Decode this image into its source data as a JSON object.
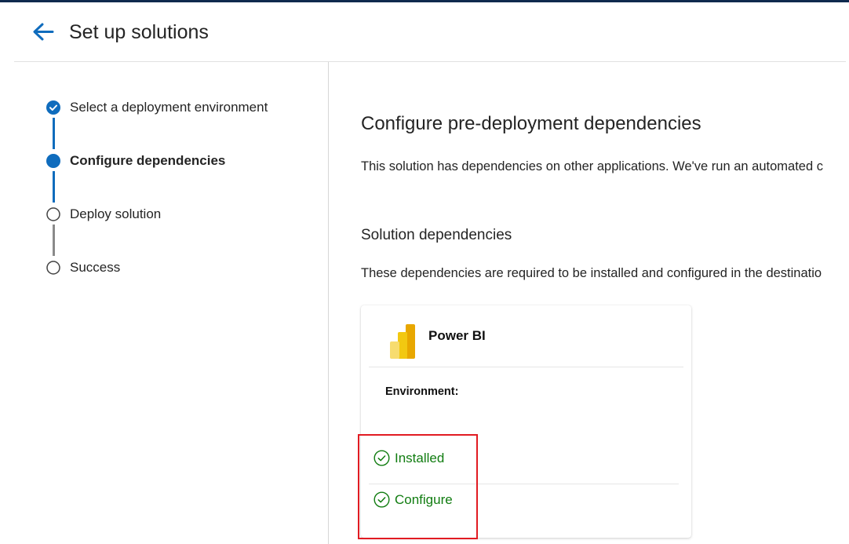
{
  "header": {
    "title": "Set up solutions",
    "back_icon": "arrow-left-icon"
  },
  "colors": {
    "accent": "#0f6cbd",
    "success": "#107c10",
    "highlight": "#e11b22",
    "top_bar": "#0f2a4e"
  },
  "steps": [
    {
      "label": "Select a deployment environment",
      "state": "completed"
    },
    {
      "label": "Configure dependencies",
      "state": "current"
    },
    {
      "label": "Deploy solution",
      "state": "pending"
    },
    {
      "label": "Success",
      "state": "pending"
    }
  ],
  "main": {
    "title": "Configure pre-deployment dependencies",
    "description": "This solution has dependencies on other applications. We've run an automated c",
    "section_title": "Solution dependencies",
    "section_description": "These dependencies are required to be installed and configured in the destinatio"
  },
  "dependency_card": {
    "app_name": "Power BI",
    "app_icon": "power-bi-icon",
    "environment_label": "Environment:",
    "statuses": [
      {
        "label": "Installed",
        "icon": "check-circle-icon"
      },
      {
        "label": "Configure",
        "icon": "check-circle-icon"
      }
    ]
  }
}
